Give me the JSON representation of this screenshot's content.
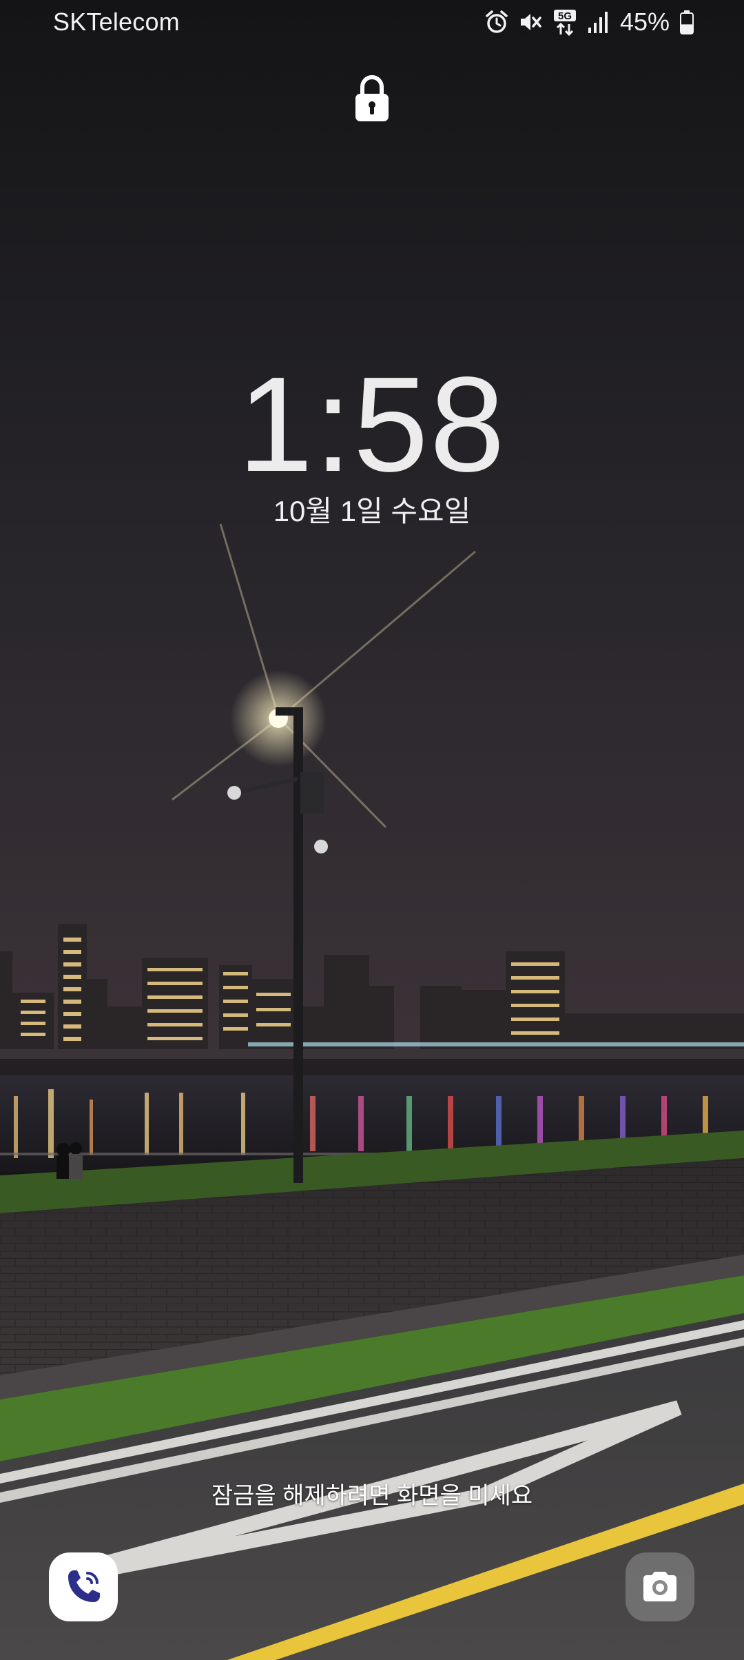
{
  "status_bar": {
    "carrier": "SKTelecom",
    "icons": [
      "alarm-icon",
      "vibrate-mute-icon",
      "5g-data-icon",
      "signal-icon"
    ],
    "network_label": "5G",
    "battery_percent": "45%",
    "battery_level": 0.45
  },
  "lock_screen": {
    "time": "1:58",
    "date": "10월 1일 수요일",
    "unlock_hint": "잠금을 해제하려면 화면을 미세요",
    "lock_icon": "padlock-icon"
  },
  "shortcuts": {
    "left": {
      "icon": "phone-icon",
      "accent": "#2b2f8a"
    },
    "right": {
      "icon": "camera-icon"
    }
  },
  "wallpaper": {
    "description_colors": {
      "sky": "#1b1a1d",
      "grass": "#3f6b23",
      "road_line_yellow": "#e9c53c"
    }
  }
}
